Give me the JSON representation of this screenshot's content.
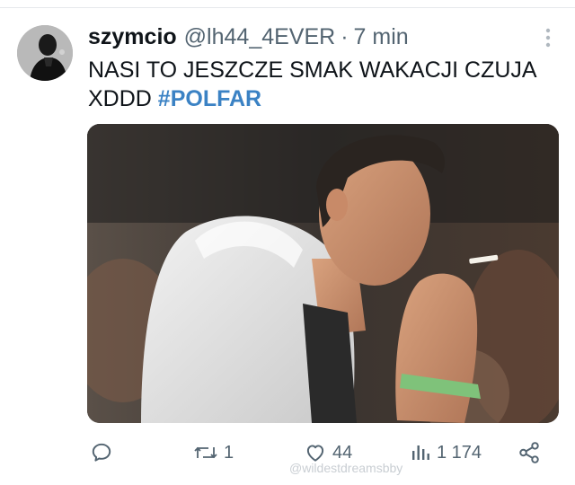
{
  "tweet": {
    "display_name": "szymcio",
    "handle": "@lh44_4EVER",
    "separator": "·",
    "time": "7 min",
    "text_line1": "NASI TO JESZCZE SMAK WAKACJI  CZUJA",
    "text_line2_prefix": "XDDD ",
    "hashtag": "#POLFAR",
    "media_icon": "photo",
    "avatar_icon": "avatar-photo",
    "more_icon": "more-vertical-icon"
  },
  "actions": {
    "reply": {
      "icon": "reply-icon"
    },
    "retweet": {
      "icon": "retweet-icon",
      "count": "1"
    },
    "like": {
      "icon": "heart-icon",
      "count": "44"
    },
    "views": {
      "icon": "views-icon",
      "count": "1 174"
    },
    "share": {
      "icon": "share-icon"
    }
  },
  "watermark": "@wildestdreamsbby",
  "colors": {
    "text": "#0f1419",
    "secondary": "#536471",
    "hashtag": "#3b82c4",
    "border": "#e6e9ec"
  }
}
